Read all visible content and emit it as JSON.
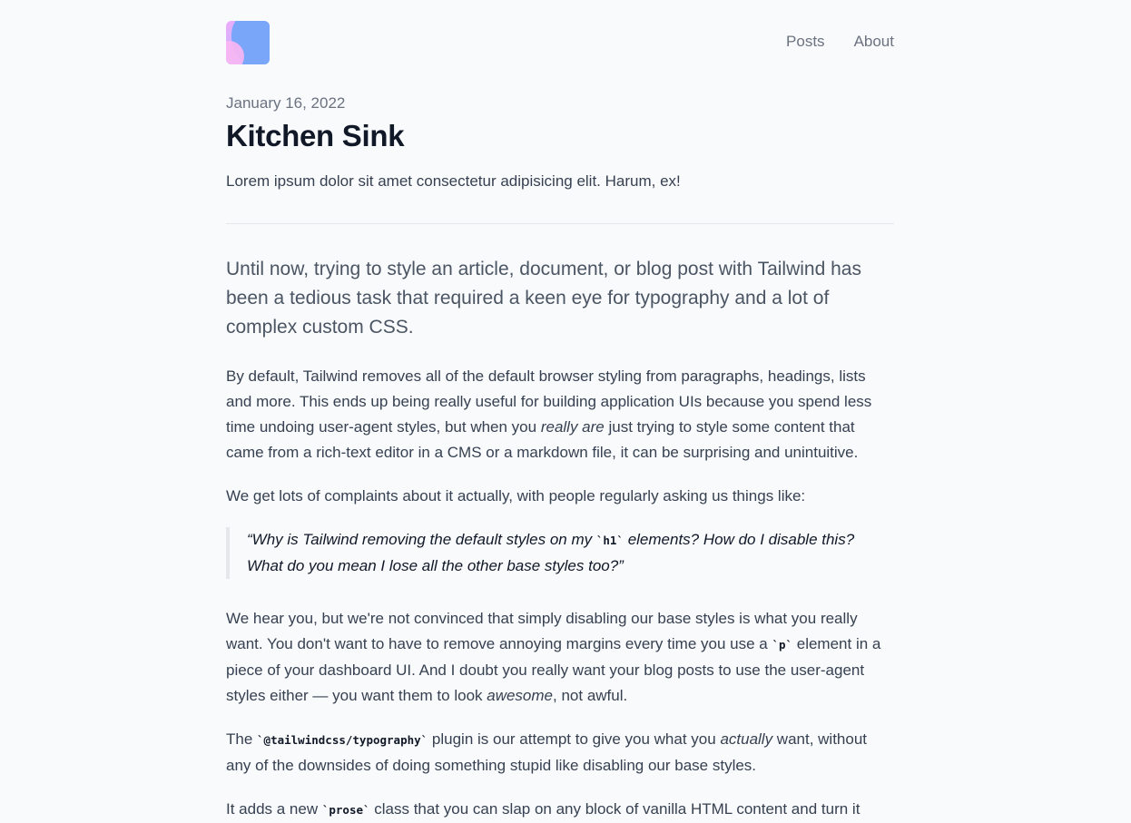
{
  "nav": {
    "items": [
      "Posts",
      "About"
    ]
  },
  "post": {
    "date": "January 16, 2022",
    "title": "Kitchen Sink",
    "subtitle": "Lorem ipsum dolor sit amet consectetur adipisicing elit. Harum, ex!"
  },
  "article": {
    "lead": "Until now, trying to style an article, document, or blog post with Tailwind has been a tedious task that required a keen eye for typography and a lot of complex custom CSS.",
    "p1": {
      "before": "By default, Tailwind removes all of the default browser styling from paragraphs, headings, lists and more. This ends up being really useful for building application UIs because you spend less time undoing user-agent styles, but when you ",
      "em": "really are",
      "after": " just trying to style some content that came from a rich-text editor in a CMS or a markdown file, it can be surprising and unintuitive."
    },
    "p2": "We get lots of complaints about it actually, with people regularly asking us things like:",
    "quote": {
      "before": "“Why is Tailwind removing the default styles on my ",
      "code": "`h1`",
      "after": " elements? How do I disable this? What do you mean I lose all the other base styles too?”"
    },
    "p3": {
      "a": "We hear you, but we're not convinced that simply disabling our base styles is what you really want. You don't want to have to remove annoying margins every time you use a ",
      "code": "`p`",
      "b": " element in a piece of your dashboard UI. And I doubt you really want your blog posts to use the user-agent styles either — you want them to look ",
      "em": "awesome",
      "c": ", not awful."
    },
    "p4": {
      "a": "The ",
      "code": "`@tailwindcss/typography`",
      "b": " plugin is our attempt to give you what you ",
      "em": "actually",
      "c": " want, without any of the downsides of doing something stupid like disabling our base styles."
    },
    "p5": {
      "a": "It adds a new ",
      "code": "`prose`",
      "b": " class that you can slap on any block of vanilla HTML content and turn it"
    }
  }
}
